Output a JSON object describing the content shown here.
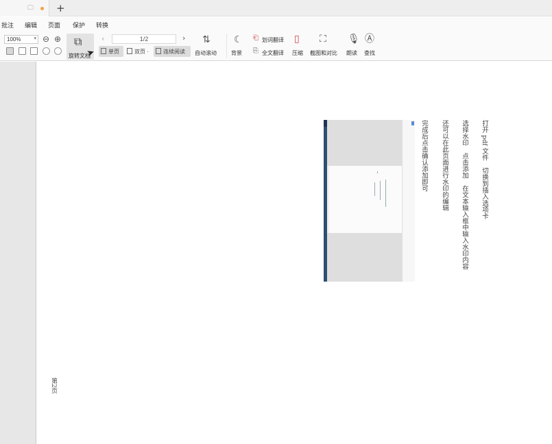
{
  "tabs": {
    "monitor_icon": "monitor-icon",
    "new_tab": "+"
  },
  "menu": {
    "items": [
      "批注",
      "编辑",
      "页面",
      "保护",
      "转换"
    ]
  },
  "toolbar": {
    "zoom_value": "100%",
    "zoom_out_icon": "zoom-out-icon",
    "zoom_in_icon": "zoom-in-icon",
    "rotate_label": "旋转文档",
    "page_prev": "‹",
    "page_next": "›",
    "page_value": "1/2",
    "single_page": "单页",
    "double_page": "双页",
    "continuous_read": "连续阅读",
    "auto_scroll": "自动滚动",
    "background": "背景",
    "word_translate": "划词翻译",
    "full_translate": "全文翻译",
    "compress": "压缩",
    "screenshot_compare": "截图和对比",
    "read_aloud": "朗读",
    "search": "查找"
  },
  "document": {
    "lines": [
      "打开 pdf 文件　切换到插入选项卡",
      "选择水印　点击添加　在文本输入框中输入水印内容",
      "还可以在此页面进行水印的编辑",
      "完成后点击确认添加即可"
    ],
    "page_label": "第2页"
  }
}
